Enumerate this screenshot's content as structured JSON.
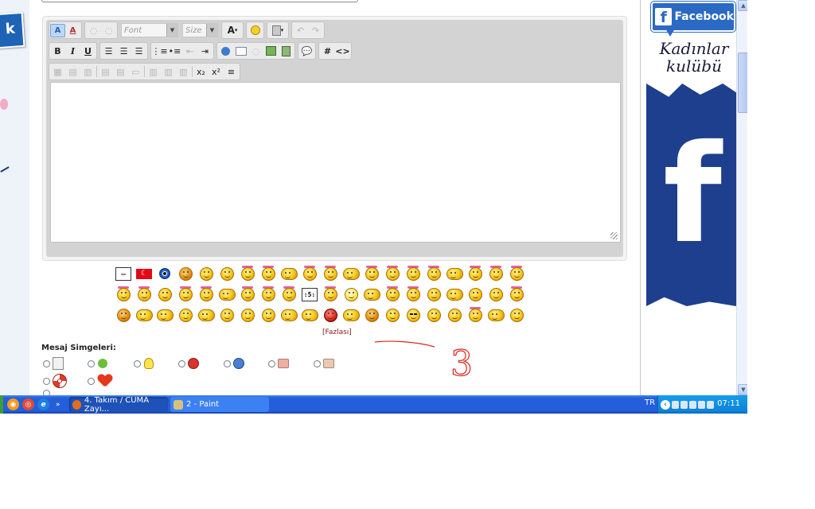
{
  "editor": {
    "font_placeholder": "Font",
    "size_placeholder": "Size",
    "toolbar_row1": [
      "A",
      "A",
      "",
      "",
      "",
      "",
      "A",
      "",
      "",
      "",
      ""
    ],
    "toolbar_row2": [
      "B",
      "I",
      "U",
      "",
      "",
      "",
      "",
      "",
      "",
      "",
      "",
      "",
      "",
      "",
      "",
      "",
      "",
      "#",
      "<>"
    ],
    "sub_label": "x₂",
    "sup_label": "x²"
  },
  "smilies": {
    "more_link": "[Fazlası]",
    "row1": [
      "sign",
      "flag",
      "eye",
      "hat",
      "face",
      "face",
      "ribbon",
      "ribbon",
      "wide",
      "ribbon",
      "ribbon",
      "wide",
      "ribbon",
      "ribbon",
      "ribbon",
      "ribbon",
      "wide",
      "ribbon",
      "ribbon",
      "ribbon"
    ],
    "row2": [
      "ribbon",
      "ribbon",
      "face",
      "ribbon",
      "ribbon",
      "wide",
      "ribbon",
      "ribbon",
      "ribbon",
      "sign5",
      "ribbon",
      "bulb",
      "wide",
      "ribbon",
      "ribbon",
      "face",
      "wide",
      "face",
      "face",
      "ribbon"
    ],
    "row3": [
      "hat",
      "wide",
      "wide",
      "face",
      "wide",
      "face",
      "face",
      "face",
      "wide",
      "wide",
      "devil",
      "wide",
      "hat",
      "face",
      "cool",
      "face",
      "face",
      "ribbon",
      "wide",
      "face"
    ],
    "sign5_text": ":5:"
  },
  "post_icons": {
    "label": "Mesaj Simgeleri:",
    "items": [
      "document-icon",
      "arrow-icon",
      "lightbulb-icon",
      "exclamation-icon",
      "question-icon",
      "thumbs-down-icon",
      "thumbs-up-icon",
      "lifebuoy-icon",
      "heart-icon"
    ]
  },
  "annotation": {
    "number": "3"
  },
  "banner": {
    "badge_text": "Facebook",
    "badge_letter": "f",
    "brand_line1": "Kadınlar",
    "brand_line2": "kulübü",
    "big_letter": "f"
  },
  "left_strip": {
    "tag_text": "k"
  },
  "taskbar": {
    "tasks": [
      {
        "label": "4. Takım / CUMA Zayı..."
      },
      {
        "label": "2 - Paint"
      }
    ],
    "language": "TR",
    "clock": "07:11"
  },
  "colors": {
    "taskbar_blue": "#245edb",
    "facebook_blue": "#2b6ac4",
    "annotation_red": "#d9271c",
    "more_link": "#8a1a1a"
  }
}
